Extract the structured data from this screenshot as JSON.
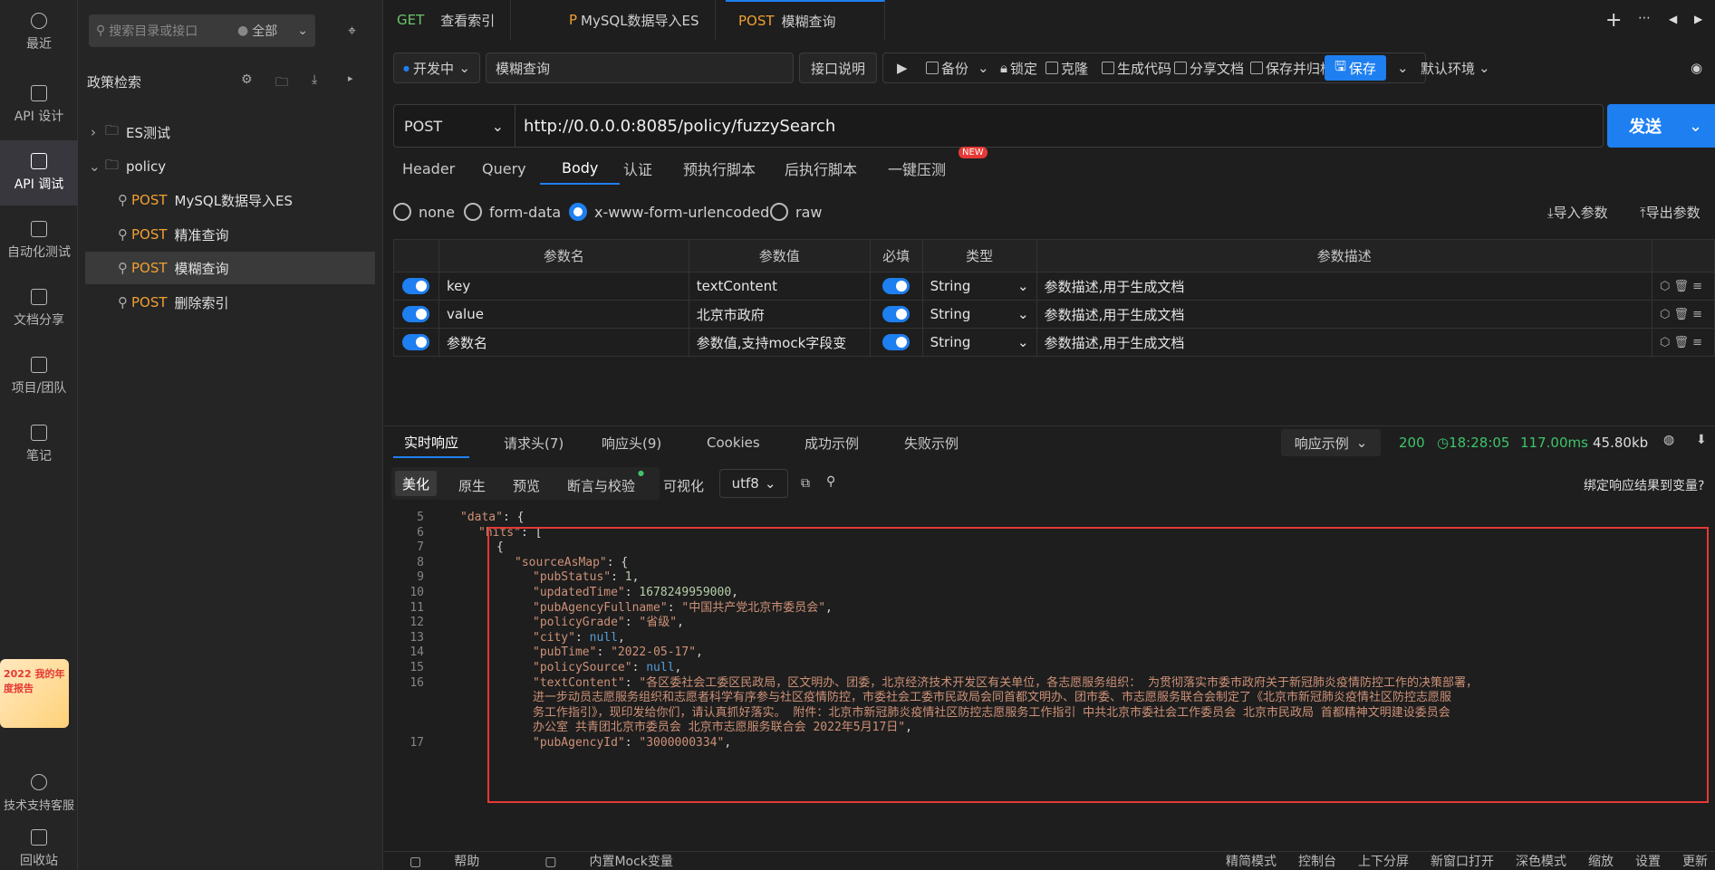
{
  "rail": {
    "items": [
      {
        "label": "最近",
        "icon": "clock-icon"
      },
      {
        "label": "API 设计",
        "icon": "design-icon"
      },
      {
        "label": "API 调试",
        "icon": "debug-icon"
      },
      {
        "label": "自动化测试",
        "icon": "automation-icon"
      },
      {
        "label": "文档分享",
        "icon": "doc-icon"
      },
      {
        "label": "项目/团队",
        "icon": "project-icon"
      },
      {
        "label": "笔记",
        "icon": "note-icon"
      }
    ],
    "support_label": "技术支持客服",
    "recycle_label": "回收站",
    "promo_text": "2022 我的年度报告"
  },
  "tree": {
    "search_placeholder": "搜索目录或接口",
    "scope": "全部",
    "section_title": "政策检索",
    "folders": [
      {
        "name": "ES测试",
        "expanded": false
      },
      {
        "name": "policy",
        "expanded": true
      }
    ],
    "items": [
      {
        "method": "POST",
        "name": "MySQL数据导入ES"
      },
      {
        "method": "POST",
        "name": "精准查询"
      },
      {
        "method": "POST",
        "name": "模糊查询",
        "selected": true
      },
      {
        "method": "POST",
        "name": "删除索引"
      }
    ]
  },
  "tabs": [
    {
      "method": "GET",
      "name": "查看索引"
    },
    {
      "method": "P",
      "name": "MySQL数据导入ES"
    },
    {
      "method": "POST",
      "name": "模糊查询",
      "active": true
    }
  ],
  "toolbar": {
    "status": "开发中",
    "api_name": "模糊查询",
    "doc_btn": "接口说明",
    "backup": "备份",
    "lock": "锁定",
    "clone": "克隆",
    "gen_code": "生成代码",
    "share_doc": "分享文档",
    "save_archive": "保存并归档",
    "save": "保存",
    "env": "默认环境"
  },
  "request": {
    "method": "POST",
    "url": "http://0.0.0.0:8085/policy/fuzzySearch",
    "send": "发送"
  },
  "subtabs": [
    "Header",
    "Query",
    "Body",
    "认证",
    "预执行脚本",
    "后执行脚本",
    "一键压测"
  ],
  "new_badge": "NEW",
  "body_types": [
    "none",
    "form-data",
    "x-www-form-urlencoded",
    "raw"
  ],
  "import_params": "导入参数",
  "export_params": "导出参数",
  "params": {
    "headers": [
      "参数名",
      "参数值",
      "必填",
      "类型",
      "参数描述"
    ],
    "rows": [
      {
        "name": "key",
        "value": "textContent",
        "type": "String",
        "desc_placeholder": "参数描述,用于生成文档"
      },
      {
        "name": "value",
        "value": "北京市政府",
        "type": "String",
        "desc_placeholder": "参数描述,用于生成文档"
      },
      {
        "name": "",
        "name_placeholder": "参数名",
        "value_placeholder": "参数值,支持mock字段变",
        "type": "String",
        "desc_placeholder": "参数描述,用于生成文档"
      }
    ]
  },
  "response": {
    "tabs": [
      "实时响应",
      "请求头(7)",
      "响应头(9)",
      "Cookies",
      "成功示例",
      "失败示例"
    ],
    "example_label": "响应示例",
    "status_code": "200",
    "time": "18:28:05",
    "duration": "117.00ms",
    "size": "45.80kb",
    "view_tabs": [
      "美化",
      "原生",
      "预览",
      "断言与校验",
      "可视化"
    ],
    "encoding": "utf8",
    "bind_label": "绑定响应结果到变量?"
  },
  "code_lines": [
    {
      "n": "5",
      "indent": 0,
      "html": "<span class='s'>\"data\"</span><span class='p'>: {</span>"
    },
    {
      "n": "6",
      "indent": 1,
      "html": "<span class='s'>\"hits\"</span><span class='p'>: [</span>"
    },
    {
      "n": "7",
      "indent": 2,
      "html": "<span class='p'>{</span>"
    },
    {
      "n": "8",
      "indent": 3,
      "html": "<span class='s'>\"sourceAsMap\"</span><span class='p'>: {</span>"
    },
    {
      "n": "9",
      "indent": 4,
      "html": "<span class='s'>\"pubStatus\"</span><span class='p'>: </span><span class='n'>1</span><span class='p'>,</span>"
    },
    {
      "n": "10",
      "indent": 4,
      "html": "<span class='s'>\"updatedTime\"</span><span class='p'>: </span><span class='n'>1678249959000</span><span class='p'>,</span>"
    },
    {
      "n": "11",
      "indent": 4,
      "html": "<span class='s'>\"pubAgencyFullname\"</span><span class='p'>: </span><span class='s'>\"中国共产党北京市委员会\"</span><span class='p'>,</span>"
    },
    {
      "n": "12",
      "indent": 4,
      "html": "<span class='s'>\"policyGrade\"</span><span class='p'>: </span><span class='s'>\"省级\"</span><span class='p'>,</span>"
    },
    {
      "n": "13",
      "indent": 4,
      "html": "<span class='s'>\"city\"</span><span class='p'>: </span><span class='kw'>null</span><span class='p'>,</span>"
    },
    {
      "n": "14",
      "indent": 4,
      "html": "<span class='s'>\"pubTime\"</span><span class='p'>: </span><span class='s'>\"2022-05-17\"</span><span class='p'>,</span>"
    },
    {
      "n": "15",
      "indent": 4,
      "html": "<span class='s'>\"policySource\"</span><span class='p'>: </span><span class='kw'>null</span><span class='p'>,</span>"
    },
    {
      "n": "16",
      "indent": 4,
      "html": "<span class='s'>\"textContent\"</span><span class='p'>: </span><span class='s'>\"各区委社会工委区民政局，区文明办、团委，北京经济技术开发区有关单位，各志愿服务组织： 为贯彻落实市委市政府关于新冠肺炎疫情防控工作的决策部署，</span>"
    },
    {
      "n": "",
      "indent": 4,
      "html": "<span class='s'>进一步动员志愿服务组织和志愿者科学有序参与社区疫情防控，市委社会工委市民政局会同首都文明办、团市委、市志愿服务联合会制定了《北京市新冠肺炎疫情社区防控志愿服</span>"
    },
    {
      "n": "",
      "indent": 4,
      "html": "<span class='s'>务工作指引》，现印发给你们，请认真抓好落实。 附件：北京市新冠肺炎疫情社区防控志愿服务工作指引 中共北京市委社会工作委员会 北京市民政局 首都精神文明建设委员会</span>"
    },
    {
      "n": "",
      "indent": 4,
      "html": "<span class='s'>办公室 共青团北京市委员会 北京市志愿服务联合会 2022年5月17日\"</span><span class='p'>,</span>"
    },
    {
      "n": "17",
      "indent": 4,
      "html": "<span class='s'>\"pubAgencyId\"</span><span class='p'>: </span><span class='s'>\"3000000334\"</span><span class='p'>,</span>"
    }
  ],
  "footer": {
    "left": [
      "帮助",
      "内置Mock变量"
    ],
    "right": [
      "精简模式",
      "控制台",
      "上下分屏",
      "新窗口打开",
      "深色模式",
      "缩放",
      "设置",
      "更新"
    ]
  }
}
